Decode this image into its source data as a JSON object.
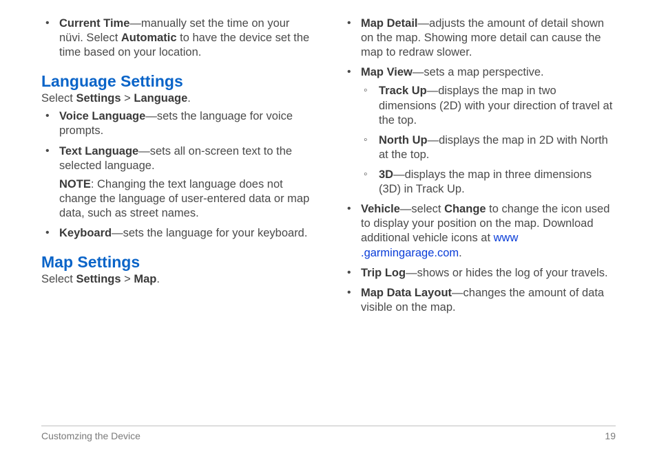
{
  "left": {
    "topItem": {
      "label": "Current Time",
      "desc_a": "—manually set the time on your nüvi. Select ",
      "bold": "Automatic",
      "desc_b": " to have the device set the time based on your location."
    },
    "langHead": "Language Settings",
    "langCrumb": {
      "a": "Select ",
      "b": "Settings",
      "sep": " > ",
      "c": "Language",
      "end": "."
    },
    "langItems": [
      {
        "label": "Voice Language",
        "desc": "—sets the language for voice prompts."
      },
      {
        "label": "Text Language",
        "desc": "—sets all on-screen text to the selected language."
      }
    ],
    "note": {
      "lead": "NOTE",
      "body": ": Changing the text language does not change the language of user-entered data or map data, such as street names."
    },
    "keyboard": {
      "label": "Keyboard",
      "desc": "—sets the language for your keyboard."
    },
    "mapHead": "Map Settings",
    "mapCrumb": {
      "a": "Select ",
      "b": "Settings",
      "sep": " > ",
      "c": "Map",
      "end": "."
    }
  },
  "right": {
    "items": {
      "detail": {
        "label": "Map Detail",
        "desc": "—adjusts the amount of detail shown on the map. Showing more detail can cause the map to redraw slower."
      },
      "view": {
        "label": "Map View",
        "desc": "—sets a map perspective.",
        "sub": [
          {
            "label": "Track Up",
            "desc": "—displays the map in two dimensions (2D) with your direction of travel at the top."
          },
          {
            "label": "North Up",
            "desc": "—displays the map in 2D with North at the top."
          },
          {
            "label": "3D",
            "desc": "—displays the map in three dimensions (3D) in Track Up."
          }
        ]
      },
      "vehicle": {
        "label": "Vehicle",
        "desc_a": "—select ",
        "bold": "Change",
        "desc_b": " to change the icon used to display your position on the map. Download additional vehicle icons at ",
        "link_a": "www",
        "link_b": ".garmingarage.com",
        "end": "."
      },
      "triplog": {
        "label": "Trip Log",
        "desc": "—shows or hides the log of your travels."
      },
      "layout": {
        "label": "Map Data Layout",
        "desc": "—changes the amount of data visible on the map."
      }
    }
  },
  "footer": {
    "section": "Customzing the Device",
    "page": "19"
  }
}
